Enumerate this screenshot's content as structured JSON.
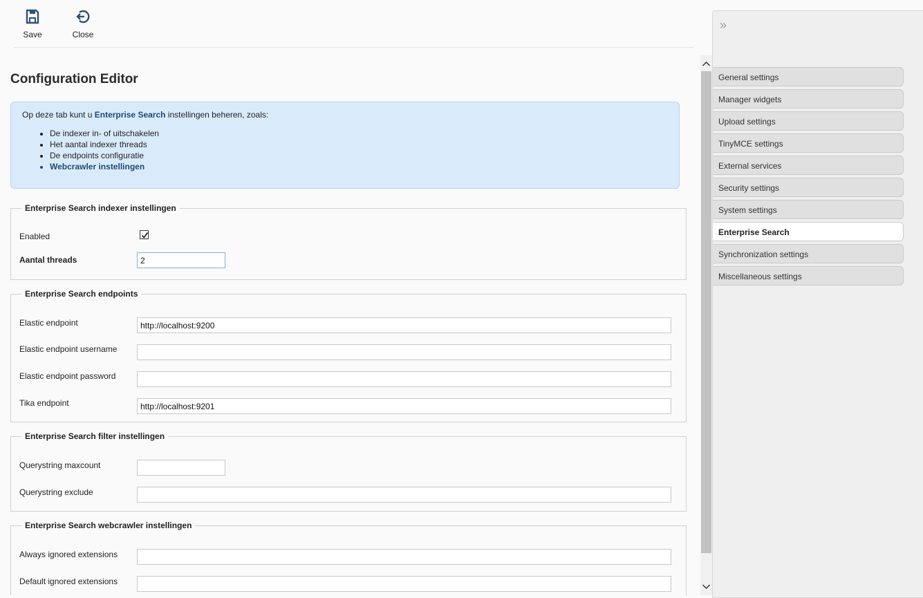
{
  "toolbar": {
    "save_label": "Save",
    "close_label": "Close"
  },
  "page": {
    "title": "Configuration Editor"
  },
  "info": {
    "intro_prefix": "Op deze tab kunt u ",
    "intro_strong": "Enterprise Search",
    "intro_suffix": " instellingen beheren, zoals:",
    "bullets": [
      "De indexer in- of uitschakelen",
      "Het aantal indexer threads",
      "De endpoints configuratie",
      "Webcrawler instellingen"
    ]
  },
  "indexer": {
    "legend": "Enterprise Search indexer instellingen",
    "enabled_label": "Enabled",
    "enabled": true,
    "threads_label": "Aantal threads",
    "threads_value": "2"
  },
  "endpoints": {
    "legend": "Enterprise Search endpoints",
    "elastic_label": "Elastic endpoint",
    "elastic_value": "http://localhost:9200",
    "username_label": "Elastic endpoint username",
    "username_value": "",
    "password_label": "Elastic endpoint password",
    "password_value": "",
    "tika_label": "Tika endpoint",
    "tika_value": "http://localhost:9201"
  },
  "filter": {
    "legend": "Enterprise Search filter instellingen",
    "maxcount_label": "Querystring maxcount",
    "maxcount_value": "",
    "exclude_label": "Querystring exclude",
    "exclude_value": ""
  },
  "webcrawler": {
    "legend": "Enterprise Search webcrawler instellingen",
    "always_label": "Always ignored extensions",
    "always_value": "",
    "default_label": "Default ignored extensions",
    "default_value": ""
  },
  "sidebar": {
    "collapse_glyph": "»",
    "items": [
      {
        "label": "General settings"
      },
      {
        "label": "Manager widgets"
      },
      {
        "label": "Upload settings"
      },
      {
        "label": "TinyMCE settings"
      },
      {
        "label": "External services"
      },
      {
        "label": "Security settings"
      },
      {
        "label": "System settings"
      },
      {
        "label": "Enterprise Search"
      },
      {
        "label": "Synchronization settings"
      },
      {
        "label": "Miscellaneous settings"
      }
    ],
    "active_index": 7
  },
  "colors": {
    "accent": "#1e4a72",
    "info_bg": "#d9ebfb",
    "icon": "#2d4f7a"
  }
}
